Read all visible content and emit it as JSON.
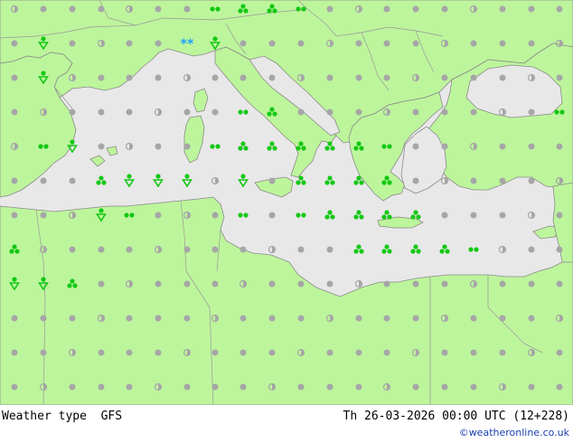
{
  "footer": {
    "product": "Weather type",
    "model": "GFS",
    "datetime": "Th 26-03-2026 00:00 UTC (12+228)",
    "credit": "©weatheronline.co.uk"
  },
  "colors": {
    "land": "#bdf59c",
    "sea": "#e8e8e8",
    "border": "#999999",
    "cloud_symbol": "#a6a6a6",
    "rain_symbol": "#14c814",
    "snow_symbol": "#1ca0ff"
  },
  "legend_symbols": [
    "overcast-dot",
    "partly-cloudy-circle",
    "drizzle-pair",
    "rain-cluster",
    "shower-triangle",
    "snow-asterisks"
  ]
}
